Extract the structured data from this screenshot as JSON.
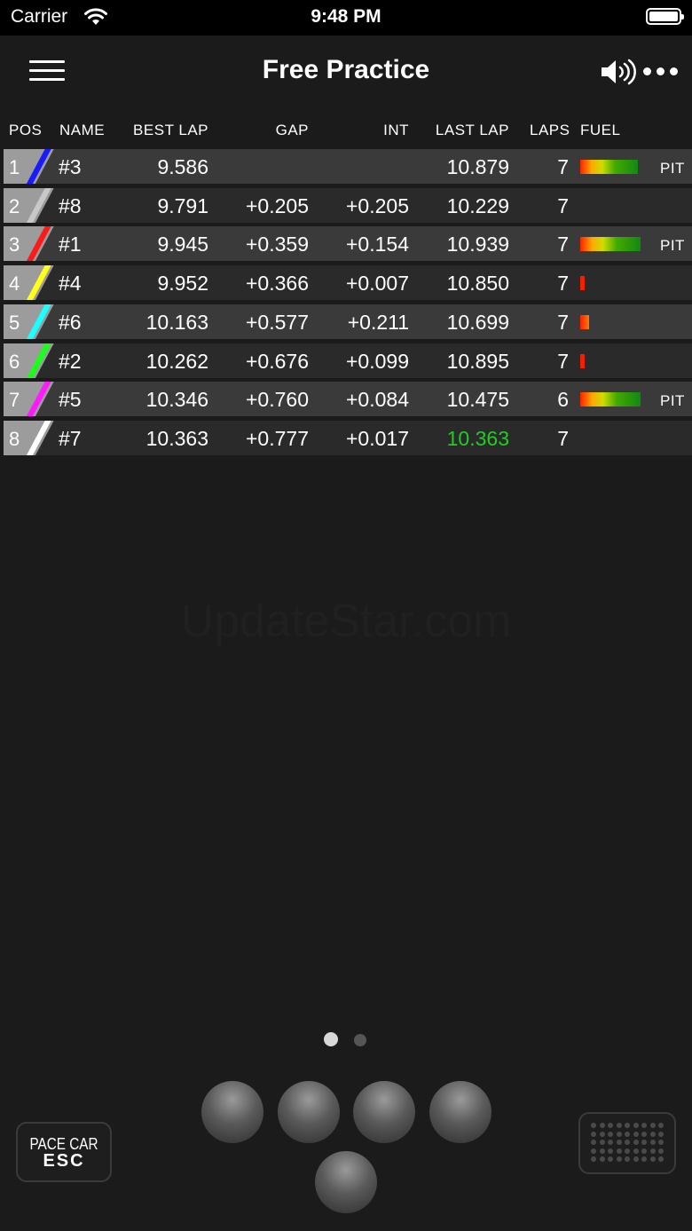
{
  "status_bar": {
    "carrier": "Carrier",
    "time": "9:48 PM"
  },
  "nav": {
    "title": "Free Practice"
  },
  "columns": {
    "pos": "POS",
    "name": "NAME",
    "best_lap": "BEST LAP",
    "gap": "GAP",
    "int": "INT",
    "last_lap": "LAST LAP",
    "laps": "LAPS",
    "fuel": "FUEL"
  },
  "rows": [
    {
      "pos": "1",
      "name": "#3",
      "best_lap": "9.586",
      "gap": "",
      "int": "",
      "last_lap": "10.879",
      "laps": "7",
      "fuel": 0.95,
      "pit": "PIT",
      "color": "#1a1aff",
      "last_lap_best": false
    },
    {
      "pos": "2",
      "name": "#8",
      "best_lap": "9.791",
      "gap": "+0.205",
      "int": "+0.205",
      "last_lap": "10.229",
      "laps": "7",
      "fuel": 0,
      "pit": "",
      "color": "#c8c8c8",
      "last_lap_best": false
    },
    {
      "pos": "3",
      "name": "#1",
      "best_lap": "9.945",
      "gap": "+0.359",
      "int": "+0.154",
      "last_lap": "10.939",
      "laps": "7",
      "fuel": 1.0,
      "pit": "PIT",
      "color": "#ff1a1a",
      "last_lap_best": false
    },
    {
      "pos": "4",
      "name": "#4",
      "best_lap": "9.952",
      "gap": "+0.366",
      "int": "+0.007",
      "last_lap": "10.850",
      "laps": "7",
      "fuel": 0.08,
      "pit": "",
      "color": "#ffff1a",
      "last_lap_best": false
    },
    {
      "pos": "5",
      "name": "#6",
      "best_lap": "10.163",
      "gap": "+0.577",
      "int": "+0.211",
      "last_lap": "10.699",
      "laps": "7",
      "fuel": 0.15,
      "pit": "",
      "color": "#1affff",
      "last_lap_best": false
    },
    {
      "pos": "6",
      "name": "#2",
      "best_lap": "10.262",
      "gap": "+0.676",
      "int": "+0.099",
      "last_lap": "10.895",
      "laps": "7",
      "fuel": 0.08,
      "pit": "",
      "color": "#1aff1a",
      "last_lap_best": false
    },
    {
      "pos": "7",
      "name": "#5",
      "best_lap": "10.346",
      "gap": "+0.760",
      "int": "+0.084",
      "last_lap": "10.475",
      "laps": "6",
      "fuel": 1.0,
      "pit": "PIT",
      "color": "#ff1aff",
      "last_lap_best": false
    },
    {
      "pos": "8",
      "name": "#7",
      "best_lap": "10.363",
      "gap": "+0.777",
      "int": "+0.017",
      "last_lap": "10.363",
      "laps": "7",
      "fuel": 0,
      "pit": "",
      "color": "#ffffff",
      "last_lap_best": true
    }
  ],
  "watermark": "UpdateStar.com",
  "pager": {
    "count": 2,
    "active": 0
  },
  "pace_car": {
    "line1": "PACE CAR",
    "line2": "ESC"
  },
  "icons": {
    "menu": "hamburger-icon",
    "sound": "speaker-icon",
    "more": "more-icon",
    "wifi": "wifi-icon",
    "battery": "battery-icon",
    "keypad": "keypad-icon"
  },
  "colors": {
    "best_lap_highlight": "#22cc22",
    "background": "#1b1b1b"
  }
}
